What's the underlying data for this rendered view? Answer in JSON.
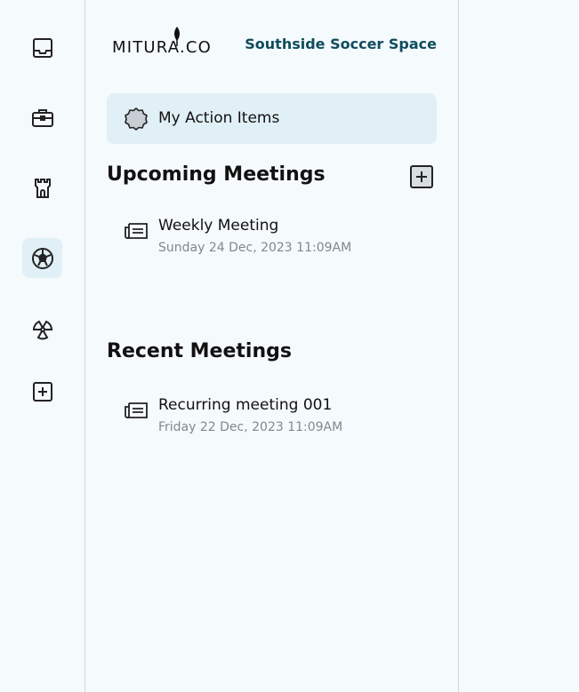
{
  "rail": {
    "items": [
      {
        "name": "inbox-icon",
        "active": false
      },
      {
        "name": "briefcase-icon",
        "active": false
      },
      {
        "name": "castle-tower-icon",
        "active": false
      },
      {
        "name": "soccer-ball-icon",
        "active": true
      },
      {
        "name": "radiation-icon",
        "active": false
      },
      {
        "name": "add-square-icon",
        "active": false
      }
    ]
  },
  "header": {
    "logo_text": "MITURA.CO",
    "space_name": "Southside Soccer Space"
  },
  "action_items": {
    "label": "My Action Items",
    "icon": "badge-icon"
  },
  "upcoming": {
    "title": "Upcoming Meetings",
    "add_icon": "add-square-icon",
    "meetings": [
      {
        "title": "Weekly Meeting",
        "date": "Sunday 24 Dec, 2023 11:09AM",
        "icon": "newspaper-icon"
      }
    ]
  },
  "recent": {
    "title": "Recent Meetings",
    "meetings": [
      {
        "title": "Recurring meeting 001",
        "date": "Friday 22 Dec, 2023 11:09AM",
        "icon": "newspaper-icon"
      }
    ]
  },
  "colors": {
    "background": "#f5fafd",
    "active_bg": "#e1eff6",
    "space_name": "#0f4c5c",
    "muted_text": "#7f8990",
    "divider": "#d3d7da"
  }
}
